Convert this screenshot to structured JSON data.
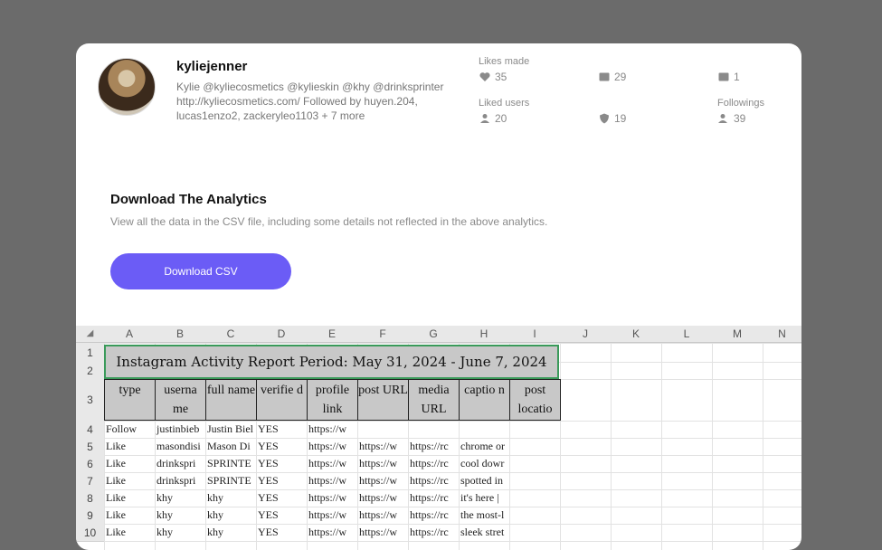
{
  "profile": {
    "username": "kyliejenner",
    "bio": "Kylie @kyliecosmetics @kylieskin @khy @drinksprinter http://kyliecosmetics.com/ Followed by huyen.204, lucas1enzo2, zackeryleo1103 + 7 more"
  },
  "stats": {
    "likes_made_label": "Likes made",
    "likes_made": "35",
    "stat2": "29",
    "stat3": "1",
    "liked_users_label": "Liked users",
    "liked_users": "20",
    "stat5": "19",
    "followings_label": "Followings",
    "followings": "39"
  },
  "download": {
    "title": "Download The Analytics",
    "description": "View all the data in the CSV file, including some details not reflected in the above analytics.",
    "button_label": "Download CSV"
  },
  "sheet": {
    "columns": [
      "A",
      "B",
      "C",
      "D",
      "E",
      "F",
      "G",
      "H",
      "I",
      "J",
      "K",
      "L",
      "M",
      "N"
    ],
    "row_numbers": [
      "1",
      "2",
      "3",
      "4",
      "5",
      "6",
      "7",
      "8",
      "9",
      "10"
    ],
    "title": "Instagram Activity Report Period: May 31, 2024 - June 7, 2024",
    "headers": [
      "type",
      "userna me",
      "full name",
      "verifie d",
      "profile link",
      "post URL",
      "media URL",
      "captio n",
      "post locatio"
    ],
    "rows": [
      [
        "Follow",
        "justinbieb",
        "Justin Biel",
        "YES",
        "https://w",
        "",
        "",
        "",
        ""
      ],
      [
        "Like",
        "masondisi",
        "Mason Di",
        "YES",
        "https://w",
        "https://w",
        "https://rc",
        "chrome or",
        ""
      ],
      [
        "Like",
        "drinkspri",
        "SPRINTE",
        "YES",
        "https://w",
        "https://w",
        "https://rc",
        "cool dowr",
        ""
      ],
      [
        "Like",
        "drinkspri",
        "SPRINTE",
        "YES",
        "https://w",
        "https://w",
        "https://rc",
        "spotted in",
        ""
      ],
      [
        "Like",
        "khy",
        "khy",
        "YES",
        "https://w",
        "https://w",
        "https://rc",
        "it's here |",
        ""
      ],
      [
        "Like",
        "khy",
        "khy",
        "YES",
        "https://w",
        "https://w",
        "https://rc",
        "the most-l",
        ""
      ],
      [
        "Like",
        "khy",
        "khy",
        "YES",
        "https://w",
        "https://w",
        "https://rc",
        "sleek stret",
        ""
      ]
    ]
  }
}
